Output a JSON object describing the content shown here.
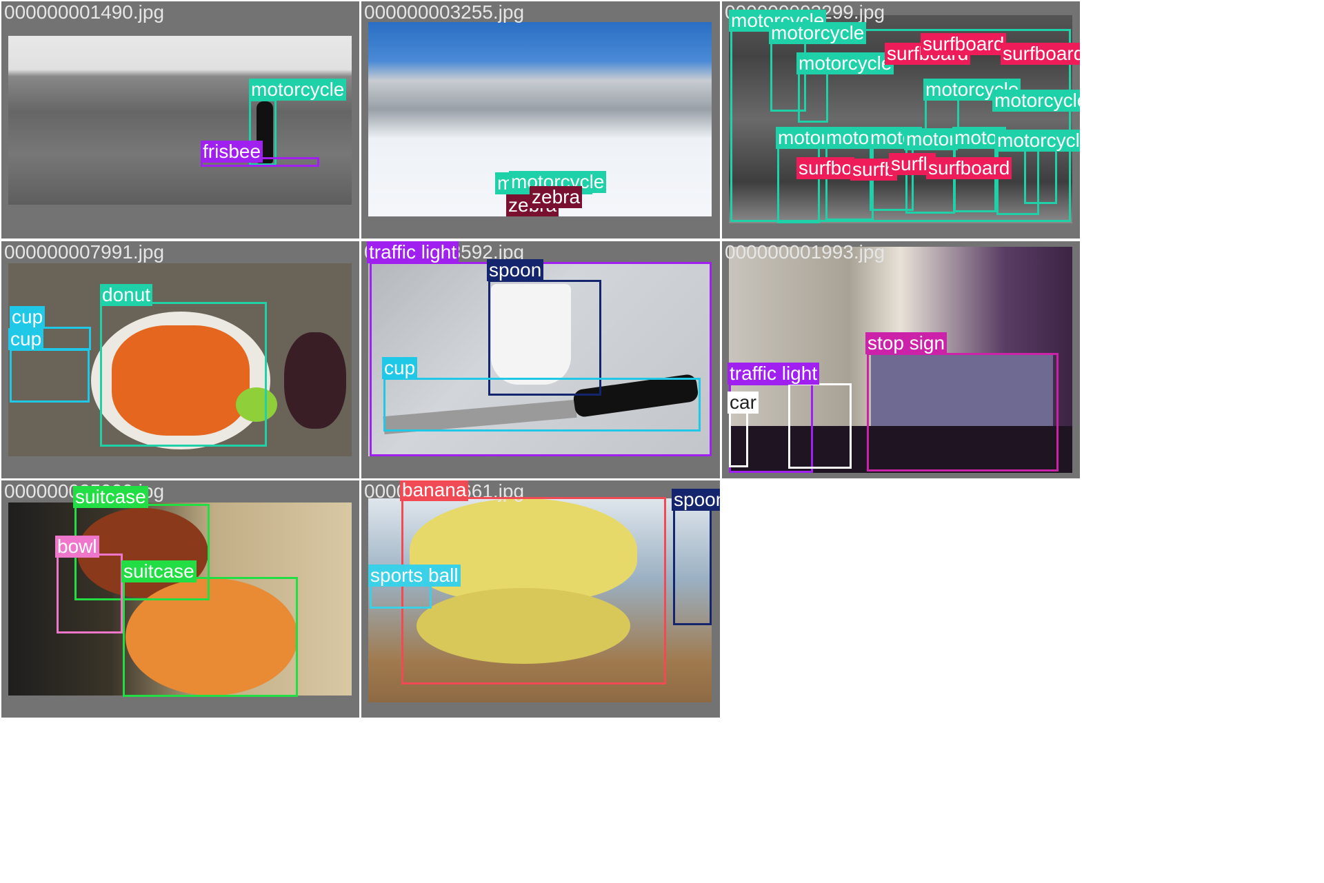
{
  "tiles": [
    {
      "filename": "000000001490.jpg",
      "labels": [
        "motorcycle",
        "frisbee"
      ]
    },
    {
      "filename": "000000003255.jpg",
      "labels": [
        "motorcycle",
        "motorcycle",
        "zebra",
        "zebra"
      ]
    },
    {
      "filename": "000000003299.jpg",
      "labels": [
        "motorcycle",
        "motorcycle",
        "motorcycle",
        "motorcycle",
        "motorcycle",
        "surfboard",
        "surfboard",
        "surfboard",
        "motor",
        "motor",
        "motor",
        "motor",
        "motor",
        "motorcycle",
        "surfbo",
        "surfb",
        "surfb",
        "surfboard"
      ]
    },
    {
      "filename": "000000007991.jpg",
      "labels": [
        "donut",
        "cup",
        "cup"
      ]
    },
    {
      "filename": "000000008592.jpg",
      "labels": [
        "traffic light",
        "spoon",
        "cup"
      ]
    },
    {
      "filename": "000000001993.jpg",
      "labels": [
        "stop sign",
        "traffic light",
        "car"
      ]
    },
    {
      "filename": "000000025000.jpg",
      "labels": [
        "suitcase",
        "bowl",
        "suitcase"
      ]
    },
    {
      "filename": "000000005661.jpg",
      "labels": [
        "banana",
        "spoon",
        "sports ball"
      ]
    }
  ],
  "colors": {
    "motorcycle": "#1fd1a8",
    "frisbee": "#a020f0",
    "zebra": "#7a1030",
    "surfboard": "#ee1d5a",
    "donut": "#1fd1a8",
    "cup": "#1ec8e6",
    "traffic_light": "#a020f0",
    "spoon": "#14256e",
    "stop_sign": "#cc22aa",
    "car": "#ffffff",
    "suitcase": "#22dd44",
    "bowl": "#ee77cc",
    "banana": "#f24a55",
    "sports_ball": "#3ad0e8",
    "tile_bg": "#737373"
  }
}
